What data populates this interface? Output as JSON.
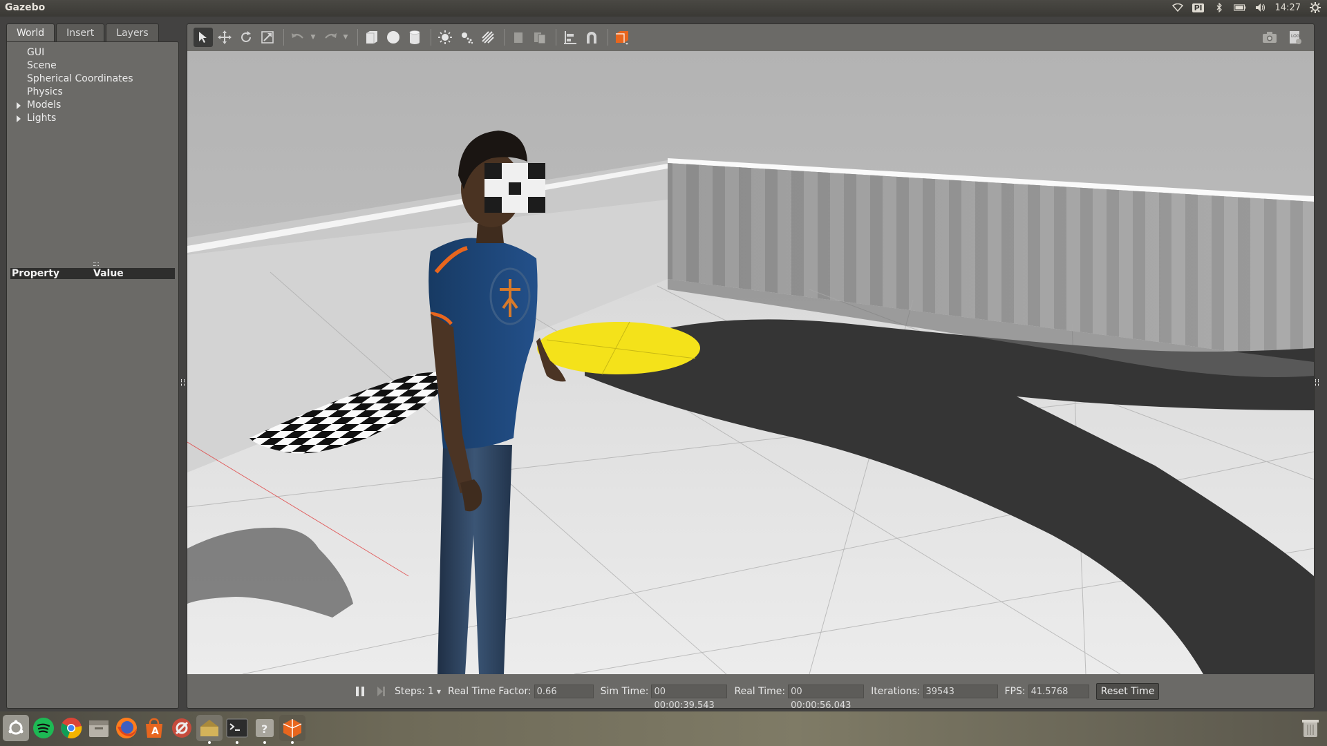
{
  "topbar": {
    "app_title": "Gazebo",
    "keyboard_layout": "Pl",
    "clock": "14:27"
  },
  "left_panel": {
    "tabs": [
      {
        "label": "World"
      },
      {
        "label": "Insert"
      },
      {
        "label": "Layers"
      }
    ],
    "tree": [
      {
        "label": "GUI",
        "expandable": false
      },
      {
        "label": "Scene",
        "expandable": false
      },
      {
        "label": "Spherical Coordinates",
        "expandable": false
      },
      {
        "label": "Physics",
        "expandable": false
      },
      {
        "label": "Models",
        "expandable": true
      },
      {
        "label": "Lights",
        "expandable": true
      }
    ],
    "property_header": {
      "property": "Property",
      "value": "Value"
    }
  },
  "toolbar": {
    "icons": [
      "select-arrow-icon",
      "translate-icon",
      "rotate-icon",
      "scale-icon",
      "undo-icon",
      "redo-icon",
      "box-icon",
      "sphere-icon",
      "cylinder-icon",
      "point-light-icon",
      "spot-light-icon",
      "directional-light-icon",
      "copy-icon",
      "paste-icon",
      "align-icon",
      "snap-icon",
      "view-angle-icon"
    ],
    "right_icons": [
      "screenshot-icon",
      "log-icon"
    ]
  },
  "statusbar": {
    "steps_label": "Steps:",
    "steps_value": "1",
    "rtf_label": "Real Time Factor:",
    "rtf_value": "0.66",
    "sim_time_label": "Sim Time:",
    "sim_time_value": "00 00:00:39.543",
    "real_time_label": "Real Time:",
    "real_time_value": "00 00:00:56.043",
    "iterations_label": "Iterations:",
    "iterations_value": "39543",
    "fps_label": "FPS:",
    "fps_value": "41.5768",
    "reset_label": "Reset Time"
  },
  "colors": {
    "accent_orange": "#e8661e",
    "floor_marker_yellow": "#f4e21a",
    "panel_bg": "#6b6a67"
  },
  "dock": {
    "items": [
      "ubuntu-icon",
      "spotify-icon",
      "chrome-icon",
      "files-icon",
      "firefox-icon",
      "software-center-icon",
      "settings-icon",
      "gazebo-icon",
      "terminal-icon",
      "help-icon",
      "3d-model-icon"
    ]
  }
}
